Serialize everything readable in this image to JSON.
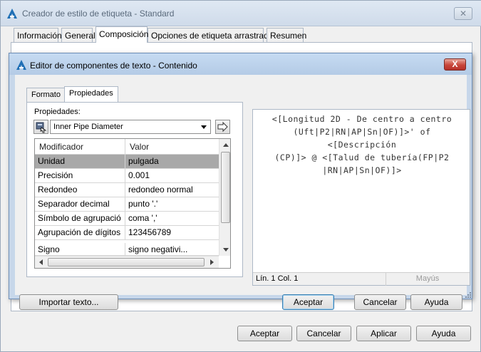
{
  "outer_window": {
    "title": "Creador de estilo de etiqueta - Standard",
    "close_glyph": "✕",
    "tabs": [
      {
        "label": "Información"
      },
      {
        "label": "General"
      },
      {
        "label": "Composición"
      },
      {
        "label": "Opciones de etiqueta arrastrada"
      },
      {
        "label": "Resumen"
      }
    ],
    "active_tab": "Composición",
    "buttons": {
      "accept": "Aceptar",
      "cancel": "Cancelar",
      "apply": "Aplicar",
      "help": "Ayuda"
    }
  },
  "dialog": {
    "title": "Editor de componentes de texto - Contenido",
    "close_glyph": "X",
    "tabs": [
      {
        "label": "Formato"
      },
      {
        "label": "Propiedades"
      }
    ],
    "active_tab": "Propiedades",
    "properties_label": "Propiedades:",
    "selected_property": "Inner Pipe Diameter",
    "grid": {
      "headers": {
        "modifier": "Modificador",
        "value": "Valor"
      },
      "rows": [
        {
          "modifier": "Unidad",
          "value": "pulgada",
          "selected": true
        },
        {
          "modifier": "Precisión",
          "value": "0.001"
        },
        {
          "modifier": "Redondeo",
          "value": "redondeo normal"
        },
        {
          "modifier": "Separador decimal",
          "value": "punto '.'"
        },
        {
          "modifier": "Símbolo de agrupació",
          "value": "coma ','"
        },
        {
          "modifier": "Agrupación de dígitos",
          "value": "123456789"
        },
        {
          "modifier": "Signo",
          "value": "signo negativi..."
        }
      ]
    },
    "editor": {
      "content": "<[Longitud 2D - De centro a centro(Uft|P2|RN|AP|Sn|OF)]>' of <[Descripción(CP)]> @ <[Talud de tubería(FP|P2|RN|AP|Sn|OF)]>",
      "lines": [
        "<[Longitud 2D - De centro a centro",
        "(Uft|P2|RN|AP|Sn|OF)]>' of <[Descripción",
        "(CP)]> @ <[Talud de tubería(FP|P2",
        "|RN|AP|Sn|OF)]>"
      ],
      "status_position": "Lín. 1 Col. 1",
      "status_caps": "Mayús"
    },
    "buttons": {
      "import_text": "Importar texto...",
      "accept": "Aceptar",
      "cancel": "Cancelar",
      "help": "Ayuda"
    }
  },
  "colors": {
    "selected_row": "#a8a8a8",
    "dialog_frame": "#c7d7ea",
    "close_button": "#c8463a"
  },
  "icons": {
    "app": "autocad-civil-icon",
    "property_picker": "property-picker-icon",
    "add_to_editor": "arrow-right-icon"
  }
}
